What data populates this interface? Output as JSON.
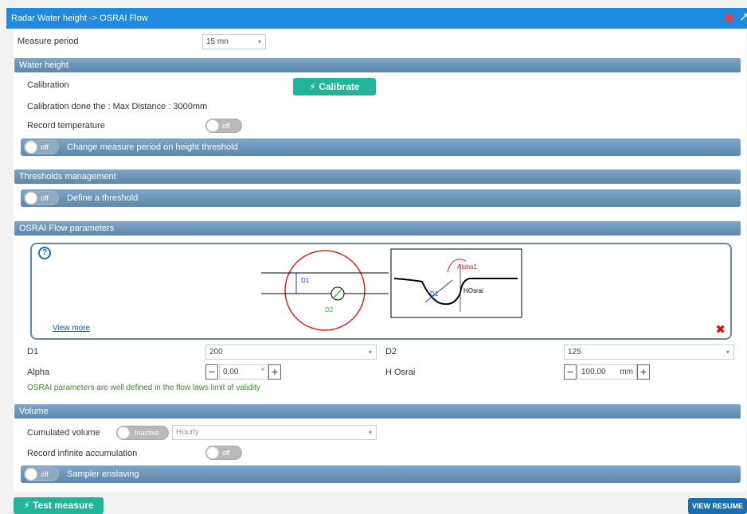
{
  "window": {
    "title": "Radar Water height -> OSRAI Flow"
  },
  "measure_period": {
    "label": "Measure period",
    "value": "15 mn"
  },
  "water_height": {
    "header": "Water height",
    "calibration_label": "Calibration",
    "calibrate_button": "Calibrate",
    "calibration_info": "Calibration done the : Max Distance : 3000mm",
    "record_temperature_label": "Record temperature",
    "record_temperature_state": "off",
    "change_period_state": "off",
    "change_period_label": "Change measure period on height threshold"
  },
  "thresholds": {
    "header": "Thresholds management",
    "define_state": "off",
    "define_label": "Define a threshold"
  },
  "osrai": {
    "header": "OSRAI Flow parameters",
    "help_icon": "?",
    "view_more": "View more",
    "diagram_left": {
      "d1": "D1",
      "d2": "D2"
    },
    "diagram_right": {
      "alpha": "Alpha1",
      "d1": "D1",
      "hosrai": "HOsrai"
    },
    "d1_label": "D1",
    "d1_value": "200",
    "d2_label": "D2",
    "d2_value": "125",
    "alpha_label": "Alpha",
    "alpha_value": "0.00",
    "alpha_unit": "°",
    "hosrai_label": "H Osrai",
    "hosrai_value": "100.00",
    "hosrai_unit": "mm",
    "validity_message": "OSRAI parameters are well defined in the flow laws limit of validity"
  },
  "volume": {
    "header": "Volume",
    "cumulated_label": "Cumulated volume",
    "cumulated_state": "Inactive",
    "cumulated_period": "Hourly",
    "infinite_label": "Record infinite accumulation",
    "infinite_state": "off",
    "sampler_state": "off",
    "sampler_label": "Sampler enslaving"
  },
  "footer": {
    "test_button": "Test measure",
    "resume_button": "VIEW RESUME"
  },
  "colors": {
    "title_bar": "#1f8ae0",
    "section": "#5d87ac",
    "green": "#1fb596",
    "blue": "#1a6fb3",
    "valid_text": "#3a8a2a"
  }
}
